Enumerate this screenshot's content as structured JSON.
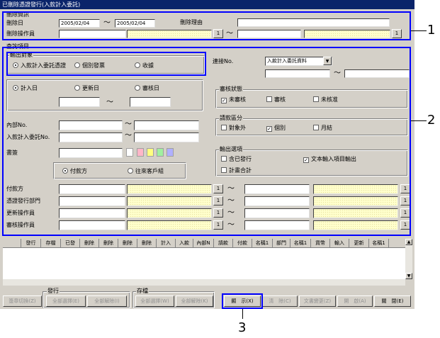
{
  "window": {
    "title": "已刪除憑證發行(入款計入委託)"
  },
  "header": {
    "section_label": "刪除資訊",
    "delete_date_label": "刪除日",
    "date_from": "2005/02/04",
    "date_to": "2005/02/04",
    "tilde": "〜",
    "reason_label": "刪除理由",
    "operator_label": "刪除操作員",
    "search_btn": "1"
  },
  "conditions": {
    "section_label": "查詢項目",
    "output_target": {
      "label": "輸出對象",
      "options": [
        "入款計入委託憑證",
        "個別發票",
        "收據"
      ],
      "selected": 0
    },
    "link_no_label": "連接No.",
    "link_select_value": "入款計入委託資料",
    "date_type": {
      "options": [
        "計入日",
        "更新日",
        "審核日"
      ],
      "selected": 0
    },
    "review_status": {
      "label": "審核狀態",
      "items": [
        {
          "label": "未審核",
          "checked": true
        },
        {
          "label": "審核",
          "checked": false
        },
        {
          "label": "未核准",
          "checked": false
        }
      ]
    },
    "request_type": {
      "label": "請款區分",
      "items": [
        {
          "label": "對象外",
          "checked": false
        },
        {
          "label": "個別",
          "checked": true
        },
        {
          "label": "月結",
          "checked": false
        }
      ]
    },
    "internal_no_label": "內部No.",
    "entrust_no_label": "入款計入委託No.",
    "document_label": "書簽",
    "payee_type": {
      "options": [
        "付款方",
        "往來客戶組"
      ],
      "selected": 0
    },
    "output_options": {
      "label": "輸出選項",
      "items": [
        {
          "label": "含已發行",
          "checked": false
        },
        {
          "label": "文本輸入項目輸出",
          "checked": true
        },
        {
          "label": "計畫合計",
          "checked": false
        }
      ]
    },
    "payer_label": "付款方",
    "issue_dept_label": "憑證發行部門",
    "update_operator_label": "更新操作員",
    "review_operator_label": "審核操作員",
    "search_btn": "1",
    "check_mark": "✓"
  },
  "grid": {
    "columns": [
      "",
      "發行",
      "存檔",
      "已發",
      "刪除",
      "刪除",
      "刪除",
      "刪除",
      "計入",
      "入款",
      "內部N",
      "請款",
      "付款",
      "名稱1",
      "部門",
      "名稱1",
      "貨幣",
      "輸入",
      "更新",
      "名稱1"
    ]
  },
  "footer": {
    "issue_group_label": "發行",
    "save_group_label": "存檔",
    "buttons": {
      "stamp": "簽章切換(Z)",
      "issue_select_all": "全部選擇(E)",
      "issue_deselect_all": "全部解除(I)",
      "save_select_all": "全部選擇(W)",
      "save_deselect_all": "全部解除(K)",
      "display": "顯　示(X)",
      "clear": "清　除(C)",
      "doc_change": "文書變更(Z)",
      "open": "開　啟(A)",
      "close": "關　閉(E)"
    }
  },
  "callouts": {
    "c1": "1",
    "c2": "2",
    "c3": "3"
  },
  "colors": {
    "callout": "#0000ff",
    "titlebar": "#0a246a"
  }
}
